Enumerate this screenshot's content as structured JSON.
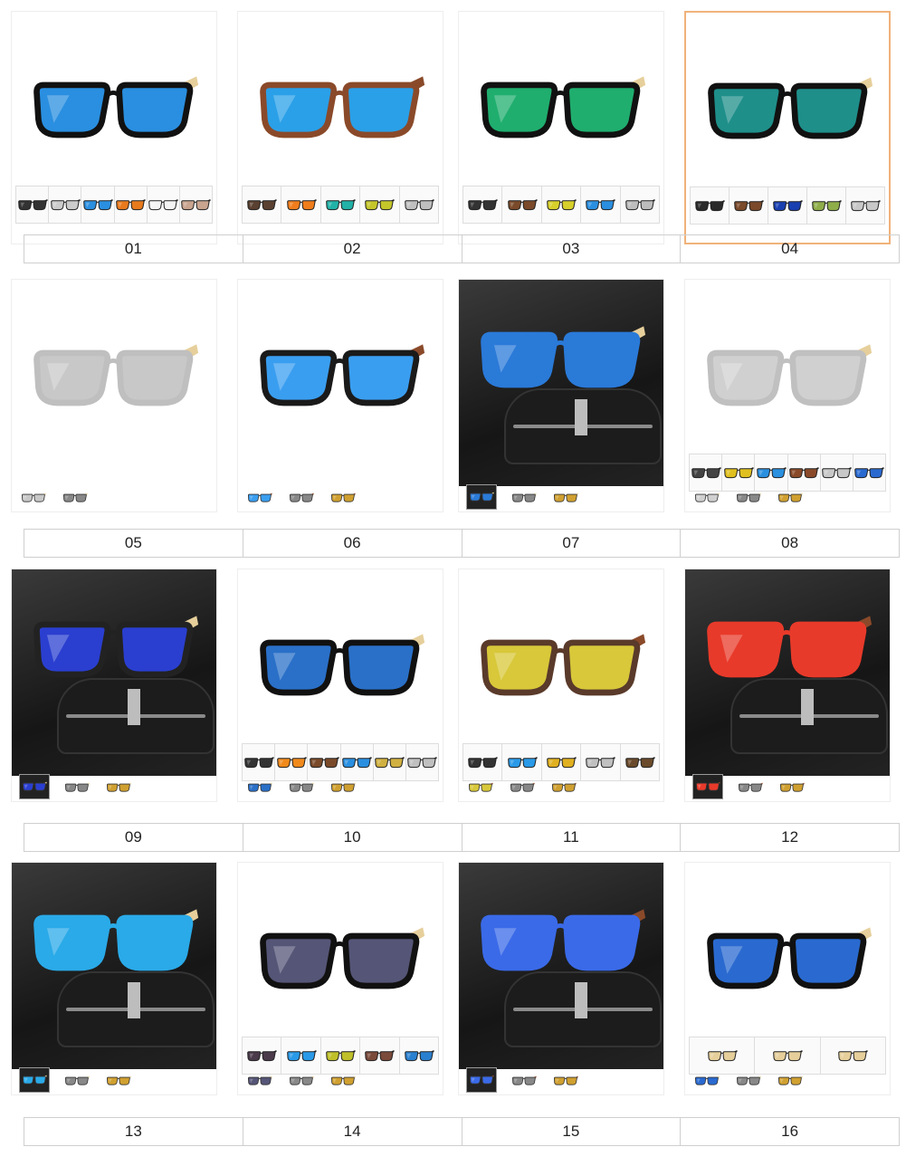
{
  "products": [
    {
      "label": "01",
      "lens": "#2a8fe0",
      "frame": "#111111",
      "arm": "#e6cf9b",
      "dark": false,
      "strip": [
        "#333333",
        "#cccccc",
        "#2a8fe0",
        "#e87a1c",
        "#f4f4f4",
        "#c9a48f"
      ],
      "mini": 0,
      "selected": false
    },
    {
      "label": "02",
      "lens": "#2aa0e8",
      "frame": "#8a4a2a",
      "arm": "#8a4a2a",
      "dark": false,
      "strip": [
        "#5a4030",
        "#f07d1c",
        "#22b2a8",
        "#c5c62a",
        "#c0c0c0"
      ],
      "mini": 0,
      "selected": false
    },
    {
      "label": "03",
      "lens": "#1fae6e",
      "frame": "#111111",
      "arm": "#e6cf9b",
      "dark": false,
      "strip": [
        "#333333",
        "#7a4a2a",
        "#d8d02a",
        "#2a8fe0",
        "#bdbdbd"
      ],
      "mini": 0,
      "selected": false
    },
    {
      "label": "04",
      "lens": "#1f8f8a",
      "frame": "#111111",
      "arm": "#e6cf9b",
      "dark": false,
      "strip": [
        "#2a2a2a",
        "#7a4a2a",
        "#1a3fb0",
        "#8fae4a",
        "#c8c8c8"
      ],
      "mini": 0,
      "selected": true
    },
    {
      "label": "05",
      "lens": "#c8c8c8",
      "frame": "#bfbfbf",
      "arm": "#e6cf9b",
      "dark": false,
      "strip": [],
      "mini": 2,
      "selected": false
    },
    {
      "label": "06",
      "lens": "#3a9ef0",
      "frame": "#1a1a1a",
      "arm": "#8a4a2a",
      "dark": false,
      "strip": [],
      "mini": 3,
      "selected": false
    },
    {
      "label": "07",
      "lens": "#2a7ad8",
      "frame": "#2a7ad8",
      "arm": "#e6cf9b",
      "dark": true,
      "strip": [],
      "mini": 3,
      "selected": false
    },
    {
      "label": "08",
      "lens": "#d0d0d0",
      "frame": "#c0c0c0",
      "arm": "#e6cf9b",
      "dark": false,
      "strip": [
        "#444444",
        "#e0c020",
        "#2a90e0",
        "#8a4a2a",
        "#c8c8c8",
        "#2a6ad0"
      ],
      "mini": 3,
      "selected": false
    },
    {
      "label": "09",
      "lens": "#2a3fd0",
      "frame": "#222222",
      "arm": "#e6cf9b",
      "dark": true,
      "strip": [],
      "mini": 3,
      "selected": false
    },
    {
      "label": "10",
      "lens": "#2a70c8",
      "frame": "#111111",
      "arm": "#e6cf9b",
      "dark": false,
      "strip": [
        "#333333",
        "#f08a1c",
        "#7a4a2a",
        "#2a8fe0",
        "#d0b040",
        "#c0c0c0"
      ],
      "mini": 3,
      "selected": false
    },
    {
      "label": "11",
      "lens": "#d8c83a",
      "frame": "#5a3a2a",
      "arm": "#8a4a2a",
      "dark": false,
      "strip": [
        "#333333",
        "#2a9ae8",
        "#e0b020",
        "#c0c0c0",
        "#6a4a2a"
      ],
      "mini": 3,
      "selected": false
    },
    {
      "label": "12",
      "lens": "#e83a2a",
      "frame": "#e83a2a",
      "arm": "#8a4a2a",
      "dark": true,
      "strip": [],
      "mini": 3,
      "selected": false
    },
    {
      "label": "13",
      "lens": "#2aaae8",
      "frame": "#2aaae8",
      "arm": "#e6cf9b",
      "dark": true,
      "strip": [],
      "mini": 3,
      "selected": false
    },
    {
      "label": "14",
      "lens": "#555577",
      "frame": "#111111",
      "arm": "#e6cf9b",
      "dark": false,
      "strip": [
        "#4a3a4a",
        "#2a9ae8",
        "#c0c02a",
        "#7a4a3a",
        "#2a80d0"
      ],
      "mini": 3,
      "selected": false
    },
    {
      "label": "15",
      "lens": "#3a6ae8",
      "frame": "#3a6ae8",
      "arm": "#8a4a2a",
      "dark": true,
      "strip": [],
      "mini": 3,
      "selected": false
    },
    {
      "label": "16",
      "lens": "#2a6ad0",
      "frame": "#111111",
      "arm": "#e6cf9b",
      "dark": false,
      "strip": [
        "#e6cf9b",
        "#e6cf9b",
        "#e6cf9b"
      ],
      "mini": 3,
      "selected": false
    }
  ]
}
